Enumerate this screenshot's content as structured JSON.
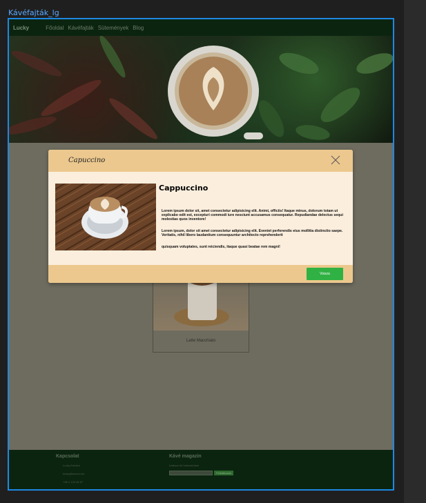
{
  "frame": {
    "label": "Kávéfajták_lg"
  },
  "navbar": {
    "brand": "Lucky",
    "links": [
      "Főoldal",
      "Kávéfajták",
      "Sütemények",
      "Blog"
    ]
  },
  "card": {
    "label": "Latte Macchiato"
  },
  "modal": {
    "title": "Capuccino",
    "heading": "Cappuccino",
    "paragraph1": "Lorem ipsum dolor sit, amet consectetur adipisicing elit. Animi, officiis! Itaque minus, dolorum totam ut explicabo odit est, excepturi commodi iure nesciunt accusamus consequatur. Repudiandae delectus sequi molestias quos inventore!",
    "paragraph2": "Lorem ipsum, dolor sit amet consectetur adipisicing elit. Eveniet  perferendis eius mollitia distinctio saepe. Veritatis, nihil libero laudantium consequuntur architecto reprehenderit",
    "paragraph3": "quisquam voluptates, sunt reiciendis, itaque quasi beatae rem magni!",
    "back_button": "Vissza"
  },
  "footer": {
    "contact_title": "Kapcsolat",
    "contact_lines": [
      "Lucky Kávézó",
      "lucky@kavezo.hu",
      "+36 1 123 45 67"
    ],
    "newsletter_title": "Kávé magazin",
    "newsletter_text": "Iratkozz fel hírlevelünkre",
    "subscribe_button": "Feliratkozás"
  },
  "colors": {
    "modal_header": "#ecc88e",
    "modal_body": "#fbeedd",
    "back_button": "#30b144",
    "navbar": "#0b2410",
    "selection": "#1e88e5"
  }
}
